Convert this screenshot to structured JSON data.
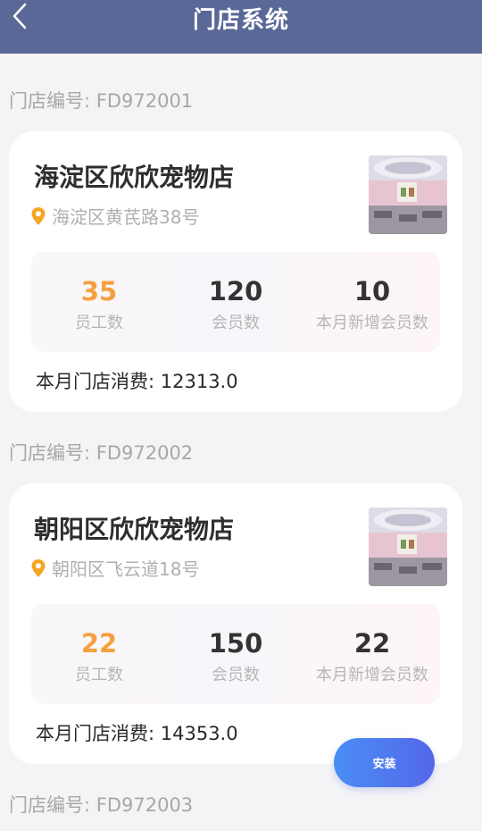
{
  "header": {
    "title": "门店系统",
    "back_icon": "chevron-left-icon"
  },
  "colors": {
    "header_bg": "#5a6898",
    "accent_orange": "#f5a040",
    "install_blue": "#4a8ef6"
  },
  "stores": [
    {
      "code_label": "门店编号: FD972001",
      "name": "海淀区欣欣宠物店",
      "address": "海淀区黄芪路38号",
      "staff": "35",
      "staff_label": "员工数",
      "members": "120",
      "members_label": "会员数",
      "new_members": "10",
      "new_members_label": "本月新增会员数",
      "spend": "本月门店消费: 12313.0"
    },
    {
      "code_label": "门店编号: FD972002",
      "name": "朝阳区欣欣宠物店",
      "address": "朝阳区飞云道18号",
      "staff": "22",
      "staff_label": "员工数",
      "members": "150",
      "members_label": "会员数",
      "new_members": "22",
      "new_members_label": "本月新增会员数",
      "spend": "本月门店消费: 14353.0"
    },
    {
      "code_label": "门店编号: FD972003"
    }
  ],
  "install_button": {
    "label": "安装"
  }
}
